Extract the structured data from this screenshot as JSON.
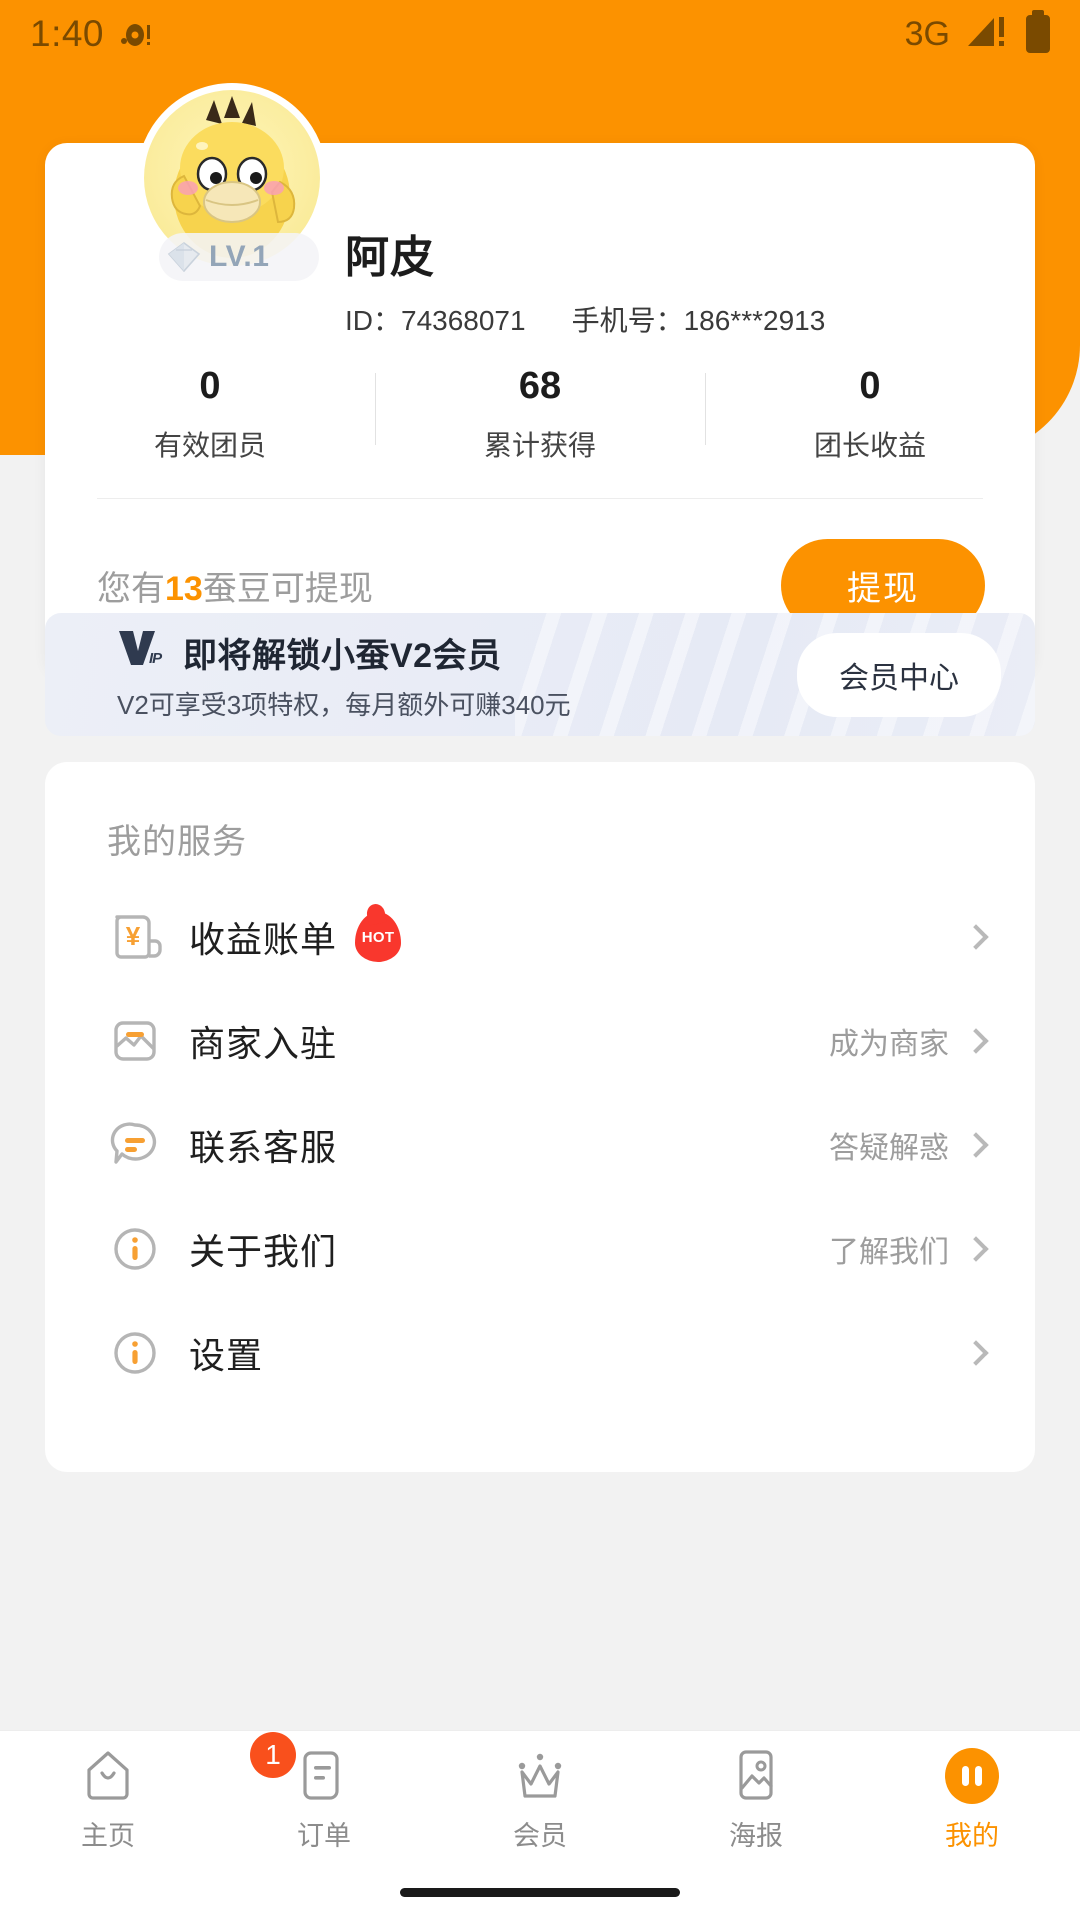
{
  "status_bar": {
    "time": "1:40",
    "network": "3G",
    "icons": [
      "record-dot-icon",
      "signal-warning-icon",
      "battery-icon"
    ]
  },
  "profile": {
    "avatar_alt": "duck-avatar",
    "level_badge": "LV.1",
    "name": "阿皮",
    "id_label": "ID：74368071",
    "phone_label": "手机号：186***2913",
    "stats": [
      {
        "value": "0",
        "label": "有效团员"
      },
      {
        "value": "68",
        "label": "累计获得"
      },
      {
        "value": "0",
        "label": "团长收益"
      }
    ],
    "withdraw": {
      "prefix": "您有",
      "amount": "13",
      "suffix": "蚕豆可提现",
      "button": "提现"
    }
  },
  "vip_banner": {
    "logo": "VIP",
    "title": "即将解锁小蚕V2会员",
    "subtitle": "V2可享受3项特权，每月额外可赚340元",
    "button": "会员中心"
  },
  "services": {
    "title": "我的服务",
    "items": [
      {
        "label": "收益账单",
        "value": "",
        "badge": "HOT",
        "icon": "receipt-yen-icon"
      },
      {
        "label": "商家入驻",
        "value": "成为商家",
        "badge": "",
        "icon": "store-icon"
      },
      {
        "label": "联系客服",
        "value": "答疑解惑",
        "badge": "",
        "icon": "chat-bubble-icon"
      },
      {
        "label": "关于我们",
        "value": "了解我们",
        "badge": "",
        "icon": "info-circle-icon"
      },
      {
        "label": "设置",
        "value": "",
        "badge": "",
        "icon": "info-circle-icon"
      }
    ]
  },
  "bottom_nav": {
    "items": [
      {
        "label": "主页",
        "icon": "home-icon",
        "badge": "",
        "active": false
      },
      {
        "label": "订单",
        "icon": "order-icon",
        "badge": "1",
        "active": false
      },
      {
        "label": "会员",
        "icon": "crown-icon",
        "badge": "",
        "active": false
      },
      {
        "label": "海报",
        "icon": "picture-icon",
        "badge": "",
        "active": false
      },
      {
        "label": "我的",
        "icon": "profile-icon",
        "badge": "",
        "active": true
      }
    ]
  },
  "colors": {
    "brand_orange": "#fc9200",
    "badge_red": "#f9501c",
    "hot_red": "#f9372d",
    "page_bg": "#f2f2f2"
  }
}
